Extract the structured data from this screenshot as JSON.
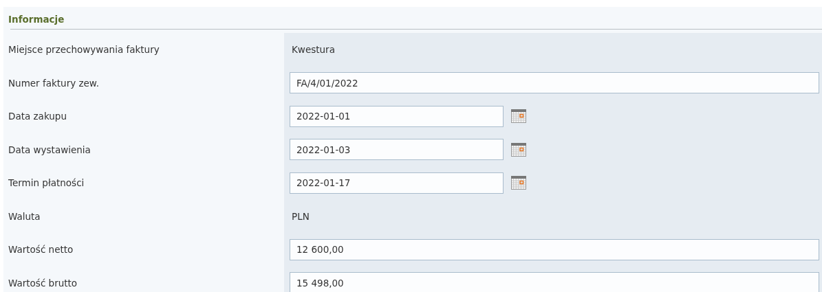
{
  "section": {
    "title": "Informacje"
  },
  "fields": [
    {
      "label": "Miejsce przechowywania faktury",
      "kind": "text",
      "value": "Kwestura"
    },
    {
      "label": "Numer faktury zew.",
      "kind": "input",
      "value": "FA/4/01/2022"
    },
    {
      "label": "Data zakupu",
      "kind": "date",
      "value": "2022-01-01"
    },
    {
      "label": "Data wystawienia",
      "kind": "date",
      "value": "2022-01-03"
    },
    {
      "label": "Termin płatności",
      "kind": "date",
      "value": "2022-01-17"
    },
    {
      "label": "Waluta",
      "kind": "text",
      "value": "PLN"
    },
    {
      "label": "Wartość netto",
      "kind": "input",
      "value": "12 600,00"
    },
    {
      "label": "Wartość brutto",
      "kind": "input",
      "value": "15 498,00"
    }
  ]
}
